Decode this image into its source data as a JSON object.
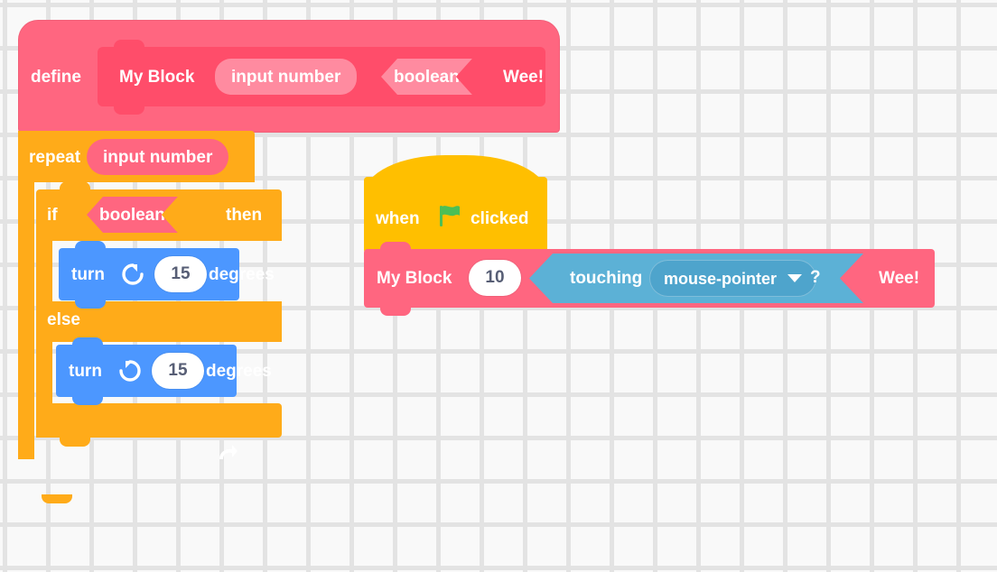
{
  "canvas": {
    "background_color": "#F9F9F9",
    "grid_dot_color": "#E3E3E3",
    "grid_spacing_px": 48
  },
  "palette": {
    "my_blocks_pink": "#FF6680",
    "my_blocks_prototype": "#FF4D6A",
    "my_blocks_arg": "#FF8BA0",
    "control_orange": "#FFAB19",
    "events_yellow": "#FFBF00",
    "motion_blue": "#4C97FF",
    "sensing_blue": "#5CB1D6",
    "sensing_dropdown": "#4EA4CC",
    "flag_green": "#4CBF56",
    "input_white": "#FFFFFF",
    "input_text": "#575E75"
  },
  "scripts": {
    "definition": {
      "define_label": "define",
      "prototype": {
        "name": "My Block",
        "arg_number_label": "input number",
        "arg_boolean_label": "boolean",
        "trailing_label": "Wee!"
      },
      "body": {
        "repeat": {
          "label": "repeat",
          "argument": "input number",
          "loop_icon": "loop-arrow-icon"
        },
        "if_else": {
          "if_label": "if",
          "condition": "boolean",
          "then_label": "then",
          "else_label": "else",
          "if_branch": {
            "turn_label": "turn",
            "direction_icon": "turn-clockwise-icon",
            "degrees_value": "15",
            "degrees_label": "degrees"
          },
          "else_branch": {
            "turn_label": "turn",
            "direction_icon": "turn-counterclockwise-icon",
            "degrees_value": "15",
            "degrees_label": "degrees"
          }
        }
      }
    },
    "call_script": {
      "hat": {
        "when_label": "when",
        "flag_icon": "green-flag-icon",
        "clicked_label": "clicked"
      },
      "call": {
        "name": "My Block",
        "number_value": "10",
        "boolean_arg": {
          "label": "touching",
          "dropdown_value": "mouse-pointer",
          "dropdown_icon": "chevron-down-icon",
          "question_mark": "?"
        },
        "trailing_label": "Wee!"
      }
    }
  }
}
